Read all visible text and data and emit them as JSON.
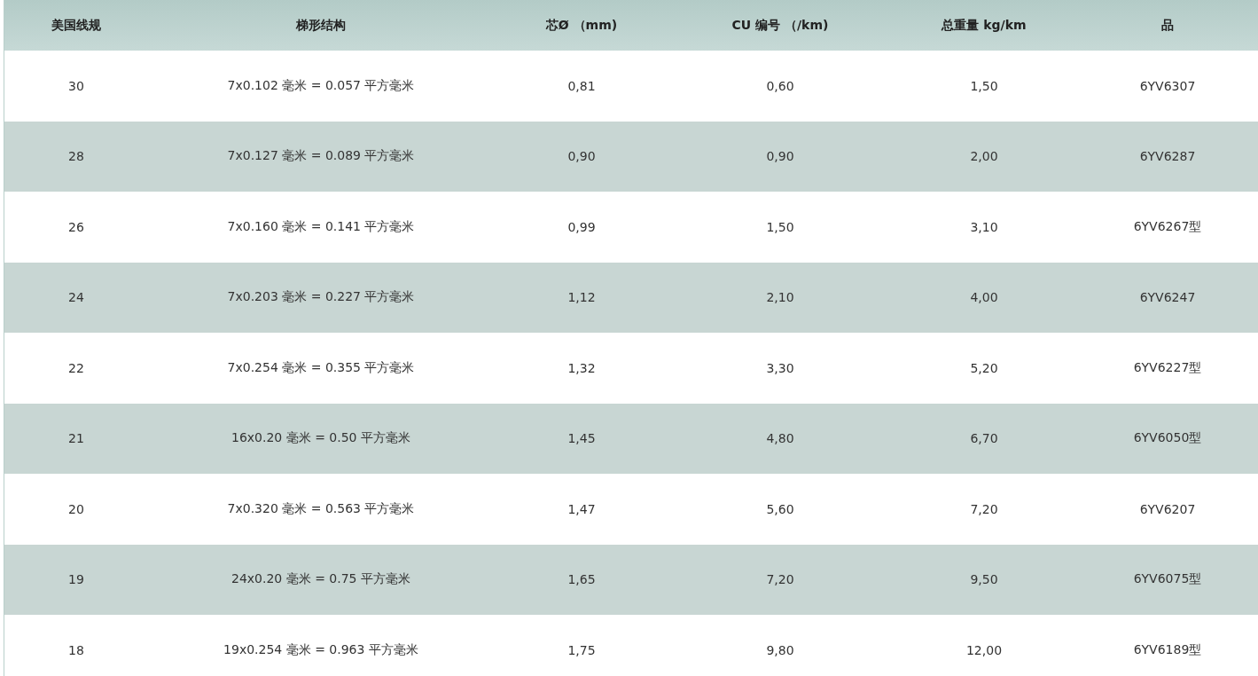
{
  "table": {
    "columns": [
      "美国线规",
      "梯形结构",
      "芯Ø （mm)",
      "CU 编号 （/km)",
      "总重量 kg/km",
      "品"
    ],
    "rows": [
      [
        "30",
        "7x0.102 毫米 = 0.057 平方毫米",
        "0,81",
        "0,60",
        "1,50",
        "6YV6307"
      ],
      [
        "28",
        "7x0.127 毫米 = 0.089 平方毫米",
        "0,90",
        "0,90",
        "2,00",
        "6YV6287"
      ],
      [
        "26",
        "7x0.160 毫米 = 0.141 平方毫米",
        "0,99",
        "1,50",
        "3,10",
        "6YV6267型"
      ],
      [
        "24",
        "7x0.203 毫米 = 0.227 平方毫米",
        "1,12",
        "2,10",
        "4,00",
        "6YV6247"
      ],
      [
        "22",
        "7x0.254 毫米 = 0.355 平方毫米",
        "1,32",
        "3,30",
        "5,20",
        "6YV6227型"
      ],
      [
        "21",
        "16x0.20 毫米 = 0.50 平方毫米",
        "1,45",
        "4,80",
        "6,70",
        "6YV6050型"
      ],
      [
        "20",
        "7x0.320 毫米 = 0.563 平方毫米",
        "1,47",
        "5,60",
        "7,20",
        "6YV6207"
      ],
      [
        "19",
        "24x0.20 毫米 = 0.75 平方毫米",
        "1,65",
        "7,20",
        "9,50",
        "6YV6075型"
      ],
      [
        "18",
        "19x0.254 毫米 = 0.963 平方毫米",
        "1,75",
        "9,80",
        "12,00",
        "6YV6189型"
      ]
    ]
  }
}
